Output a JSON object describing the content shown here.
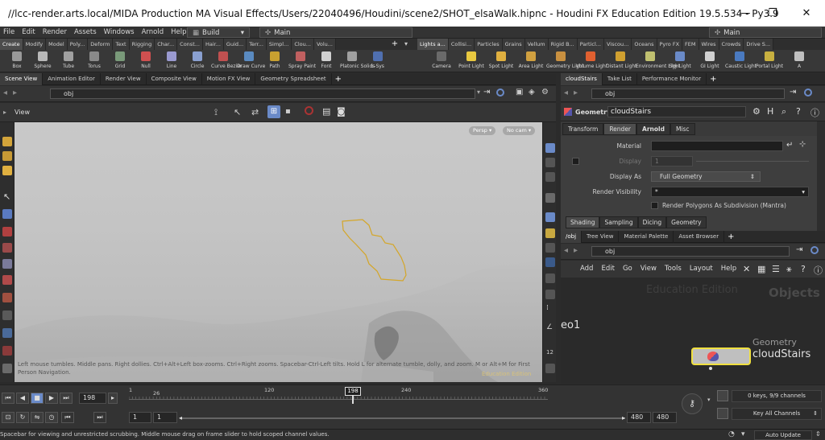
{
  "window": {
    "title": "//lcc-render.arts.local/MIDA Production MA Visual Effects/Users/22040496/Houdini/scene2/SHOT_elsaWalk.hipnc - Houdini FX Education Edition 19.5.534 - Py3.9",
    "minimize": "—",
    "restore": "❐",
    "close": "✕"
  },
  "menu": {
    "items": [
      "File",
      "Edit",
      "Render",
      "Assets",
      "Windows",
      "Arnold",
      "Help"
    ],
    "desktop": "Build",
    "desktop_right": "Main",
    "desktop_far": "Main"
  },
  "shelf_tabs_left": [
    "Create",
    "Modify",
    "Model",
    "Poly...",
    "Deform",
    "Text",
    "Rigging",
    "Char...",
    "Const...",
    "Hair...",
    "Guid...",
    "Terr...",
    "Simpl...",
    "Clou...",
    "Volu..."
  ],
  "shelf_tabs_right": [
    "Lights a...",
    "Collisi...",
    "Particles",
    "Grains",
    "Vellum",
    "Rigid B...",
    "Particl...",
    "Viscou...",
    "Oceans",
    "Pyro FX",
    "FEM",
    "Wires",
    "Crowds",
    "Drive S..."
  ],
  "shelf_tools_left": [
    {
      "label": "Box",
      "icon": "box-icon"
    },
    {
      "label": "Sphere",
      "icon": "sphere-icon"
    },
    {
      "label": "Tube",
      "icon": "tube-icon"
    },
    {
      "label": "Torus",
      "icon": "torus-icon"
    },
    {
      "label": "Grid",
      "icon": "grid-icon"
    },
    {
      "label": "Null",
      "icon": "null-icon"
    },
    {
      "label": "Line",
      "icon": "line-icon"
    },
    {
      "label": "Circle",
      "icon": "circle-icon"
    },
    {
      "label": "Curve Bezier",
      "icon": "curve-bezier-icon"
    },
    {
      "label": "Draw Curve",
      "icon": "draw-curve-icon"
    },
    {
      "label": "Path",
      "icon": "path-icon"
    },
    {
      "label": "Spray Paint",
      "icon": "spray-paint-icon"
    },
    {
      "label": "Font",
      "icon": "font-icon"
    },
    {
      "label": "Platonic Solids",
      "icon": "platonic-solids-icon"
    },
    {
      "label": "L-Sys",
      "icon": "l-system-icon"
    }
  ],
  "shelf_tools_right": [
    {
      "label": "Camera",
      "icon": "camera-icon"
    },
    {
      "label": "Point Light",
      "icon": "point-light-icon"
    },
    {
      "label": "Spot Light",
      "icon": "spot-light-icon"
    },
    {
      "label": "Area Light",
      "icon": "area-light-icon"
    },
    {
      "label": "Geometry Light",
      "icon": "geometry-light-icon"
    },
    {
      "label": "Volume Light",
      "icon": "volume-light-icon"
    },
    {
      "label": "Distant Light",
      "icon": "distant-light-icon"
    },
    {
      "label": "Environment Light",
      "icon": "environment-light-icon"
    },
    {
      "label": "Sky Light",
      "icon": "sky-light-icon"
    },
    {
      "label": "GI Light",
      "icon": "gi-light-icon"
    },
    {
      "label": "Caustic Light",
      "icon": "caustic-light-icon"
    },
    {
      "label": "Portal Light",
      "icon": "portal-light-icon"
    },
    {
      "label": "A",
      "icon": "ambient-light-icon"
    }
  ],
  "left_pane_tabs": [
    "Scene View",
    "Animation Editor",
    "Render View",
    "Composite View",
    "Motion FX View",
    "Geometry Spreadsheet"
  ],
  "left_path": "obj",
  "viewport": {
    "title": "View",
    "persp": "Persp ▾",
    "cam": "No cam ▾",
    "help": "Left mouse tumbles. Middle pans. Right dollies. Ctrl+Alt+Left box-zooms. Ctrl+Right zooms. Spacebar-Ctrl-Left tilts. Hold L for alternate tumble, dolly, and zoom.     M or Alt+M for First Person Navigation.",
    "watermark": "Education Edition"
  },
  "param_pane": {
    "tabs": [
      "cloudStairs",
      "Take List",
      "Performance Monitor"
    ],
    "path": "obj",
    "node_type": "Geometry",
    "node_name": "cloudStairs",
    "main_tabs": [
      "Transform",
      "Render",
      "Arnold",
      "Misc"
    ],
    "rows": [
      {
        "label": "Material",
        "value": ""
      },
      {
        "label": "Display",
        "value": "1"
      },
      {
        "label": "Display As",
        "value": "Full Geometry"
      },
      {
        "label": "Render Visibility",
        "value": "*"
      }
    ],
    "checkbox_label": "Render Polygons As Subdivision (Mantra)",
    "sub_tabs": [
      "Shading",
      "Sampling",
      "Dicing",
      "Geometry"
    ]
  },
  "network_pane": {
    "tabs": [
      "/obj",
      "Tree View",
      "Material Palette",
      "Asset Browser"
    ],
    "path": "obj",
    "menu": [
      "Add",
      "Edit",
      "Go",
      "View",
      "Tools",
      "Layout",
      "Help"
    ],
    "watermark": "Education Edition",
    "context": "Objects",
    "partial_node": "eo1",
    "node_type": "Geometry",
    "node_name": "cloudStairs"
  },
  "timeline": {
    "frame": "198",
    "marker": "198",
    "ticks": [
      "1",
      "26",
      "120",
      "240",
      "360"
    ],
    "start1": "1",
    "start2": "1",
    "end1": "480",
    "end2": "480",
    "keys": "0 keys, 9/9 channels",
    "channels": "Key All Channels"
  },
  "status": {
    "message": "Spacebar for viewing and unrestricted scrubbing. Middle mouse drag on frame slider to hold scoped channel values.",
    "auto_update": "Auto Update"
  }
}
